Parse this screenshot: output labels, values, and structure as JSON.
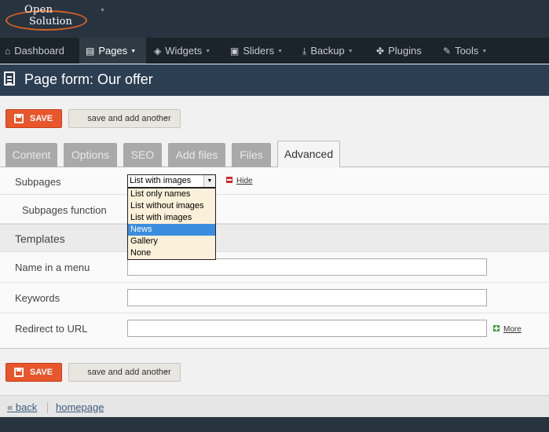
{
  "brand": {
    "line1": "Open",
    "line2": "Solution"
  },
  "nav": {
    "items": [
      {
        "label": "Dashboard",
        "icon": "home-icon",
        "dropdown": false
      },
      {
        "label": "Pages",
        "icon": "page-icon",
        "dropdown": true
      },
      {
        "label": "Widgets",
        "icon": "cube-icon",
        "dropdown": true
      },
      {
        "label": "Sliders",
        "icon": "picture-icon",
        "dropdown": true
      },
      {
        "label": "Backup",
        "icon": "download-icon",
        "dropdown": true
      },
      {
        "label": "Plugins",
        "icon": "puzzle-icon",
        "dropdown": false
      },
      {
        "label": "Tools",
        "icon": "wrench-icon",
        "dropdown": true
      }
    ]
  },
  "page": {
    "title": "Page form: Our offer"
  },
  "actions": {
    "save_label": "SAVE",
    "another_label": "save and add another"
  },
  "tabs": [
    {
      "label": "Content"
    },
    {
      "label": "Options"
    },
    {
      "label": "SEO"
    },
    {
      "label": "Add files"
    },
    {
      "label": "Files"
    },
    {
      "label": "Advanced"
    }
  ],
  "form": {
    "subpages": {
      "label": "Subpages",
      "selected": "List with images",
      "hide_label": "Hide",
      "options": [
        "List only names",
        "List without images",
        "List with images",
        "News",
        "Gallery",
        "None"
      ],
      "highlighted": "News"
    },
    "subpages_function": {
      "label": "Subpages function"
    },
    "templates": {
      "label": "Templates"
    },
    "name_in_menu": {
      "label": "Name in a menu",
      "value": ""
    },
    "keywords": {
      "label": "Keywords",
      "value": ""
    },
    "redirect": {
      "label": "Redirect to URL",
      "value": "",
      "more_label": "More"
    }
  },
  "footer": {
    "back_label": "« back",
    "homepage_label": "homepage"
  },
  "colors": {
    "save_button": "#e8562b",
    "topbar": "#273440",
    "navbar": "#1b232b",
    "titlebar": "#2c3e52",
    "dropdown_highlight": "#3c8de0",
    "dropdown_bg": "#fbf0d9",
    "brand_swoosh": "#d9601f"
  }
}
